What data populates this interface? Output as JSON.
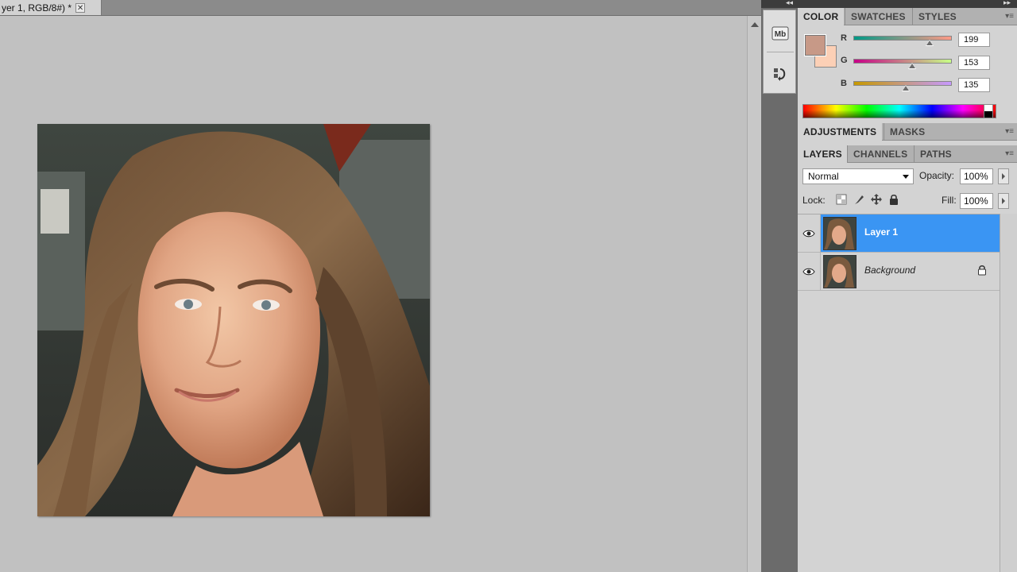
{
  "document": {
    "tab_title": "yer 1, RGB/8#) *",
    "close_glyph": "✕"
  },
  "colors": {
    "foreground": "#c79987",
    "background": "#fcd0b6",
    "selection": "#3a95f3"
  },
  "color_panel": {
    "tabs": [
      "COLOR",
      "SWATCHES",
      "STYLES"
    ],
    "active_tab": "COLOR",
    "sliders": [
      {
        "label": "R",
        "value": "199",
        "level": 0.78
      },
      {
        "label": "G",
        "value": "153",
        "level": 0.6
      },
      {
        "label": "B",
        "value": "135",
        "level": 0.53
      }
    ]
  },
  "adjustments_panel": {
    "tabs": [
      "ADJUSTMENTS",
      "MASKS"
    ],
    "active_tab": "ADJUSTMENTS"
  },
  "layers_panel": {
    "tabs": [
      "LAYERS",
      "CHANNELS",
      "PATHS"
    ],
    "active_tab": "LAYERS",
    "blend_mode": "Normal",
    "opacity_label": "Opacity:",
    "opacity_value": "100%",
    "lock_label": "Lock:",
    "fill_label": "Fill:",
    "fill_value": "100%",
    "layers": [
      {
        "name": "Layer 1",
        "selected": true,
        "locked": false
      },
      {
        "name": "Background",
        "selected": false,
        "locked": true
      }
    ]
  },
  "dock": {
    "icons": [
      "mini-bridge-icon",
      "history-icon"
    ],
    "mini_bridge_text": "Mb"
  }
}
